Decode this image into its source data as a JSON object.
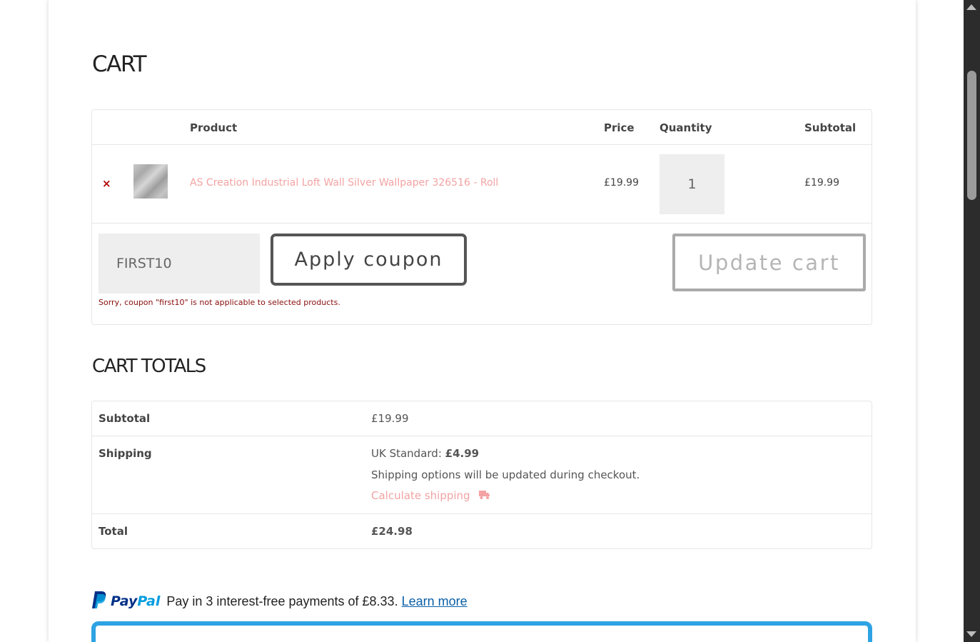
{
  "cart": {
    "title": "CART",
    "headers": {
      "product": "Product",
      "price": "Price",
      "quantity": "Quantity",
      "subtotal": "Subtotal"
    },
    "items": [
      {
        "remove_icon": "×",
        "name": "AS Creation Industrial Loft Wall Silver Wallpaper 326516 - Roll",
        "price": "£19.99",
        "quantity": "1",
        "subtotal": "£19.99"
      }
    ],
    "coupon": {
      "value": "FIRST10",
      "apply_label": "Apply coupon",
      "error": "Sorry, coupon \"first10\" is not applicable to selected products."
    },
    "update_label": "Update cart"
  },
  "totals": {
    "title": "CART TOTALS",
    "subtotal_label": "Subtotal",
    "subtotal_value": "£19.99",
    "shipping_label": "Shipping",
    "shipping_method": "UK Standard: ",
    "shipping_cost": "£4.99",
    "shipping_note": "Shipping options will be updated during checkout.",
    "calculate_shipping": "Calculate shipping",
    "total_label": "Total",
    "total_value": "£24.98"
  },
  "paypal": {
    "logo_pay": "Pay",
    "logo_pal": "Pal",
    "message": "Pay in 3 interest-free payments of £8.33.",
    "learn_more": "Learn more"
  },
  "colors": {
    "link_pink": "#f3a3a3",
    "error_red": "#8a0d0d",
    "paypal_dark": "#003087",
    "paypal_light": "#009cde",
    "checkout_border": "#2ea3e3"
  }
}
